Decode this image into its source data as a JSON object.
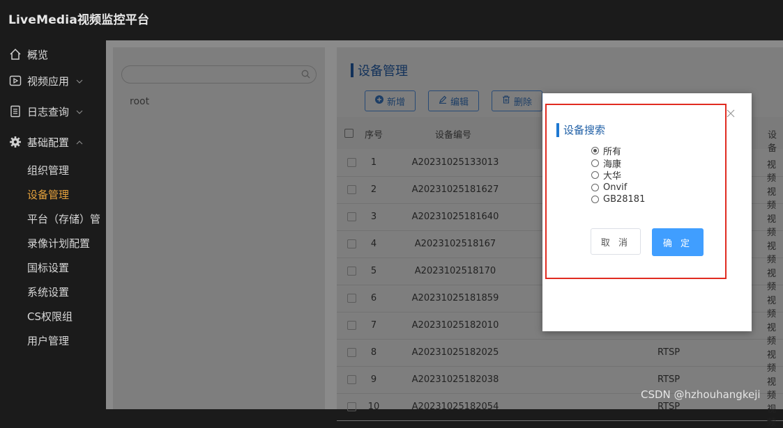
{
  "header": {
    "title": "LiveMedia视频监控平台"
  },
  "sidebar": {
    "items": [
      {
        "label": "概览",
        "icon": "home-icon"
      },
      {
        "label": "视频应用",
        "icon": "play-icon",
        "expandable": true
      },
      {
        "label": "日志查询",
        "icon": "document-icon",
        "expandable": true
      },
      {
        "label": "基础配置",
        "icon": "gear-icon",
        "expanded": true
      }
    ],
    "subitems": [
      "组织管理",
      "设备管理",
      "平台（存储）管",
      "录像计划配置",
      "国标设置",
      "系统设置",
      "CS权限组",
      "用户管理"
    ],
    "active": "设备管理",
    "active_color": "#e6a23c"
  },
  "tree": {
    "root": "root"
  },
  "main": {
    "title": "设备管理",
    "toolbar": {
      "add": "新增",
      "edit": "编辑",
      "delete": "删除"
    },
    "columns": {
      "index": "序号",
      "code": "设备编号",
      "type": "设备"
    },
    "rows": [
      {
        "index": "1",
        "code": "A20231025133013",
        "protocol": "",
        "type": "视频"
      },
      {
        "index": "2",
        "code": "A20231025181627",
        "protocol": "",
        "type": "视频"
      },
      {
        "index": "3",
        "code": "A20231025181640",
        "protocol": "",
        "type": "视频"
      },
      {
        "index": "4",
        "code": "A2023102518167",
        "protocol": "",
        "type": "视频"
      },
      {
        "index": "5",
        "code": "A2023102518170",
        "protocol": "",
        "type": "视频"
      },
      {
        "index": "6",
        "code": "A20231025181859",
        "protocol": "",
        "type": "视频"
      },
      {
        "index": "7",
        "code": "A20231025182010",
        "protocol": "",
        "type": "视频"
      },
      {
        "index": "8",
        "code": "A20231025182025",
        "protocol": "RTSP",
        "type": "视频"
      },
      {
        "index": "9",
        "code": "A20231025182038",
        "protocol": "RTSP",
        "type": "视频"
      },
      {
        "index": "10",
        "code": "A20231025182054",
        "protocol": "RTSP",
        "type": "视频"
      }
    ]
  },
  "modal": {
    "title": "设备搜索",
    "options": [
      "所有",
      "海康",
      "大华",
      "Onvif",
      "GB28181"
    ],
    "selected": "所有",
    "cancel": "取 消",
    "confirm": "确 定",
    "confirm_color": "#409eff",
    "highlight_color": "#e02b20"
  },
  "watermark": "CSDN @hzhouhangkeji"
}
